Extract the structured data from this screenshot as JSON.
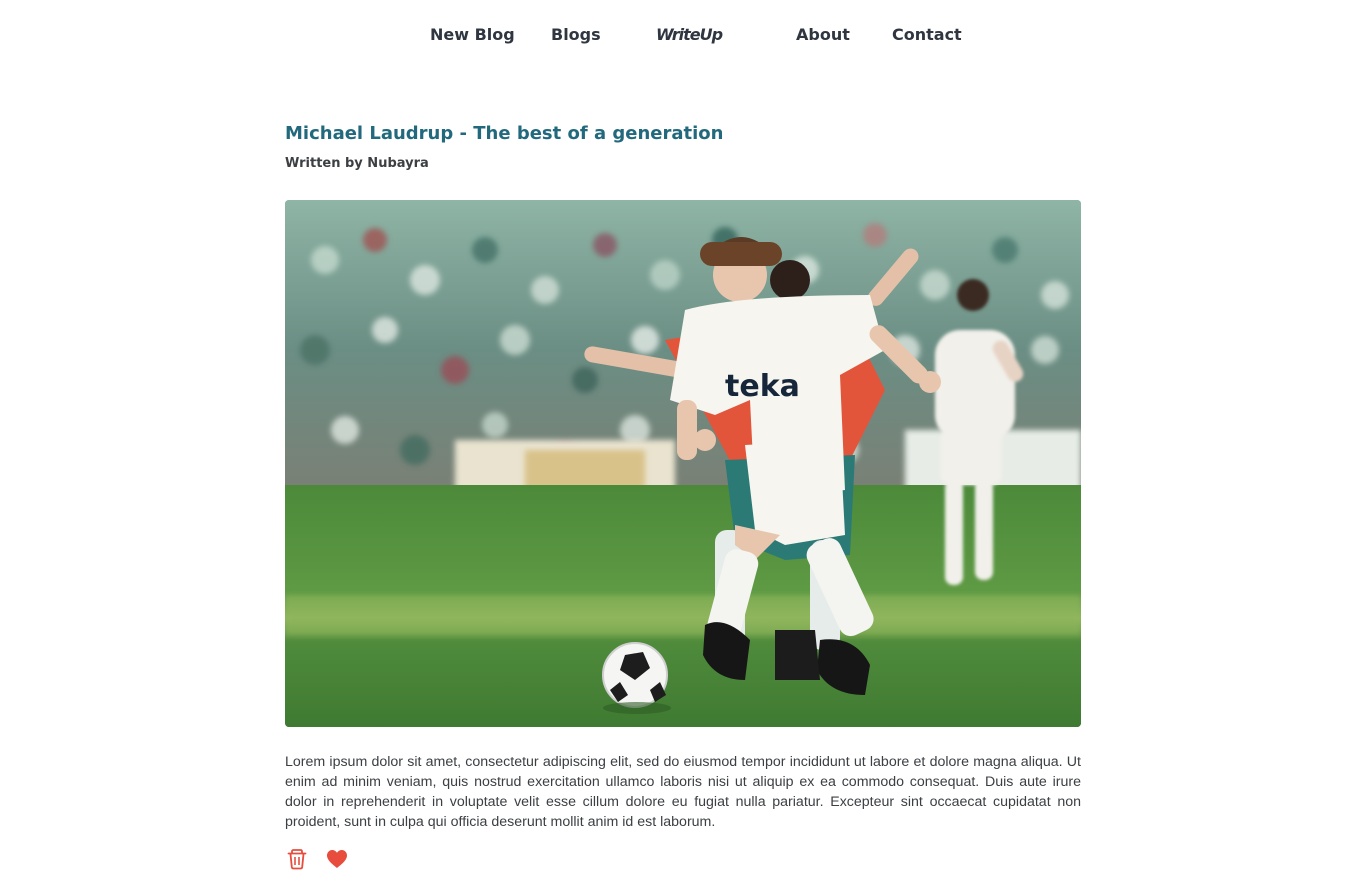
{
  "nav": {
    "items": [
      {
        "label": "New Blog"
      },
      {
        "label": "Blogs"
      },
      {
        "label": "About"
      },
      {
        "label": "Contact"
      }
    ],
    "logo": "WriteUp"
  },
  "post": {
    "title": "Michael Laudrup - The best of a generation",
    "author_line": "Written by Nubayra",
    "body": "Lorem ipsum dolor sit amet, consectetur adipiscing elit, sed do eiusmod tempor incididunt ut labore et dolore magna aliqua. Ut enim ad minim veniam, quis nostrud exercitation ullamco laboris nisi ut aliquip ex ea commodo consequat. Duis aute irure dolor in reprehenderit in voluptate velit esse cillum dolore eu fugiat nulla pariatur. Excepteur sint occaecat cupidatat non proident, sunt in culpa qui officia deserunt mollit anim id est laborum.",
    "image_alt": "Footballer in white kit dribbling the ball past an opponent",
    "jersey_text": "teka"
  },
  "actions": {
    "delete_icon": "trash-icon",
    "like_icon": "heart-icon"
  },
  "colors": {
    "accent": "#22697d",
    "nav_text": "#2f3640",
    "icon_red": "#e74c3c"
  }
}
